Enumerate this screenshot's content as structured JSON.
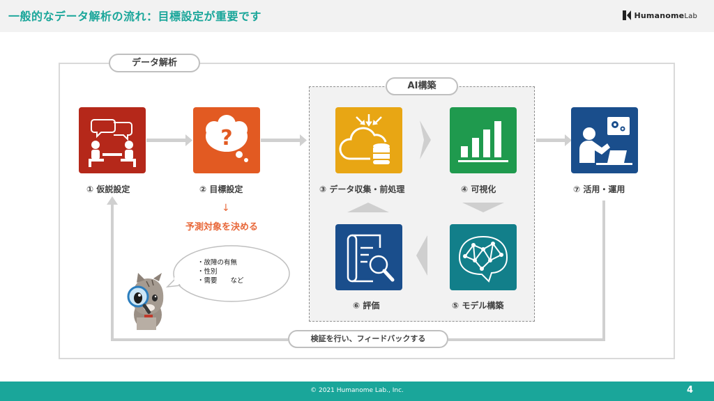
{
  "header": {
    "title": "一般的なデータ解析の流れ：目標設定が重要です",
    "logo_main": "Humanome",
    "logo_sub": "Lab"
  },
  "diagram": {
    "analysis_label": "データ解析",
    "ai_label": "AI構築",
    "verify_label": "検証を行い、フィードバックする",
    "steps": {
      "hypothesis": "① 仮説設定",
      "goal": "② 目標設定",
      "collect": "③ データ収集・前処理",
      "visualize": "④ 可視化",
      "model": "⑤ モデル構築",
      "evaluate": "⑥ 評価",
      "apply": "⑦ 活用・運用"
    },
    "goal_arrow": "↓",
    "goal_note": "予測対象を決める",
    "bubble_items": [
      "・故障の有無",
      "・性別",
      "・需要　　など"
    ]
  },
  "colors": {
    "accent": "#1aa69a",
    "red": "#b5281a",
    "orange": "#e25a22",
    "yellow": "#e8a614",
    "green": "#1f9a4e",
    "blue": "#1a4e8c",
    "teal": "#127f8a",
    "note": "#e8683a"
  },
  "footer": {
    "copyright": "© 2021 Humanome Lab., Inc.",
    "page": "4"
  }
}
